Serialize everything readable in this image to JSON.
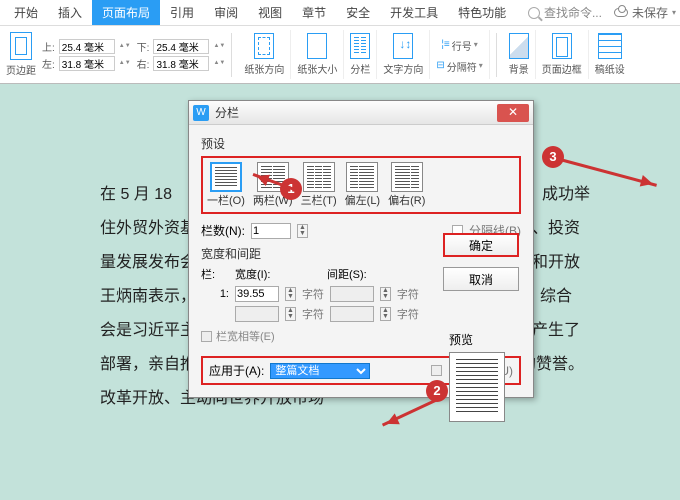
{
  "tabs": {
    "start": "开始",
    "insert": "插入",
    "page_layout": "页面布局",
    "reference": "引用",
    "review": "审阅",
    "view": "视图",
    "chapter": "章节",
    "safe": "安全",
    "dev": "开发工具",
    "special": "特色功能"
  },
  "search": {
    "placeholder": "查找命令..."
  },
  "unsaved": "未保存",
  "margins": {
    "label": "页边距",
    "top_l": "上:",
    "top_v": "25.4 毫米",
    "bottom_l": "左:",
    "bottom_v": "31.8 毫米",
    "right_top_l": "下:",
    "right_top_v": "25.4 毫米",
    "right_bot_l": "右:",
    "right_bot_v": "31.8 毫米"
  },
  "ribbon": {
    "orient": "纸张方向",
    "size": "纸张大小",
    "cols": "分栏",
    "dir": "文字方向",
    "lineno": "行号",
    "sep": "分隔符",
    "bg": "背景",
    "border": "页面边框",
    "grid": "稿纸设"
  },
  "doc": {
    "l1": "在 5 月 18",
    "l1b": "成功举",
    "l2": "住外贸外资基",
    "l2b": "、投资",
    "l3": "量发展发布会",
    "l3b": "和开放",
    "l4": "王炳南表示，",
    "l4b": "，综合",
    "l5": "会是习近平主",
    "l5b": "产生了",
    "l6": "部署，亲自推",
    "l6b": "的赞誉。",
    "l7": "改革开放、主动向世界开放市场"
  },
  "dialog": {
    "title": "分栏",
    "preset": "预设",
    "one": "一栏(O)",
    "two": "两栏(W)",
    "three": "三栏(T)",
    "left": "偏左(L)",
    "right": "偏右(R)",
    "ok": "确定",
    "cancel": "取消",
    "cols_l": "栏数(N):",
    "cols_v": "1",
    "sep_line": "分隔线(B)",
    "wid_hdr": "宽度和间距",
    "col_l": "栏:",
    "width_l": "宽度(I):",
    "spacing_l": "间距(S):",
    "row1": "1:",
    "width_v": "39.55",
    "unit": "字符",
    "equal": "栏宽相等(E)",
    "preview": "预览",
    "apply_l": "应用于(A):",
    "apply_v": "整篇文档",
    "newcol": "开始新栏(U)"
  },
  "badges": {
    "b1": "1",
    "b2": "2",
    "b3": "3"
  }
}
